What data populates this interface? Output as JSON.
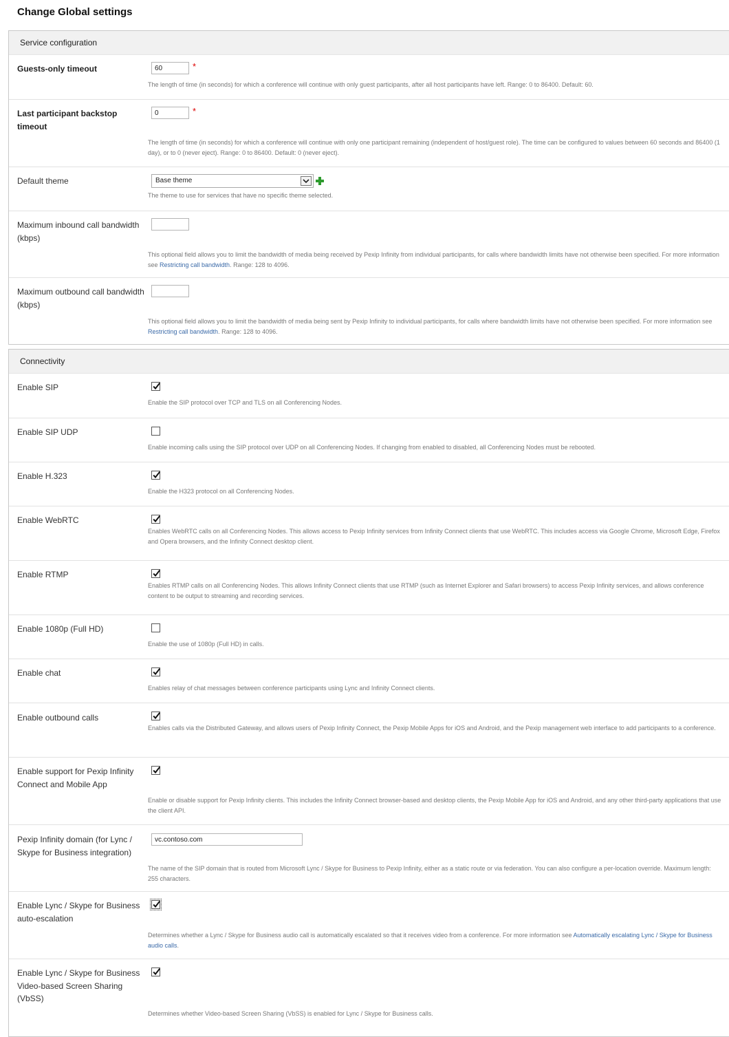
{
  "page": {
    "title": "Change Global settings"
  },
  "service_configuration": {
    "title": "Service configuration",
    "guests_only_timeout": {
      "label": "Guests-only timeout",
      "value": "60",
      "help": "The length of time (in seconds) for which a conference will continue with only guest participants, after all host participants have left. Range: 0 to 86400. Default: 60."
    },
    "last_participant_backstop": {
      "label": "Last participant backstop timeout",
      "value": "0",
      "help": "The length of time (in seconds) for which a conference will continue with only one participant remaining (independent of host/guest role). The time can be configured to values between 60 seconds and 86400 (1 day), or to 0 (never eject). Range: 0 to 86400. Default: 0 (never eject)."
    },
    "default_theme": {
      "label": "Default theme",
      "selected": "Base theme",
      "help": "The theme to use for services that have no specific theme selected."
    },
    "max_inbound_bandwidth": {
      "label": "Maximum inbound call bandwidth (kbps)",
      "value": "",
      "help_before": "This optional field allows you to limit the bandwidth of media being received by Pexip Infinity from individual participants, for calls where bandwidth limits have not otherwise been specified. For more information see ",
      "help_link": "Restricting call bandwidth",
      "help_after": ". Range: 128 to 4096."
    },
    "max_outbound_bandwidth": {
      "label": "Maximum outbound call bandwidth (kbps)",
      "value": "",
      "help_before": "This optional field allows you to limit the bandwidth of media being sent by Pexip Infinity to individual participants, for calls where bandwidth limits have not otherwise been specified. For more information see ",
      "help_link": "Restricting call bandwidth",
      "help_after": ". Range: 128 to 4096."
    }
  },
  "connectivity": {
    "title": "Connectivity",
    "rows": [
      {
        "label": "Enable SIP",
        "checked": true,
        "help": "Enable the SIP protocol over TCP and TLS on all Conferencing Nodes."
      },
      {
        "label": "Enable SIP UDP",
        "checked": false,
        "help": "Enable incoming calls using the SIP protocol over UDP on all Conferencing Nodes. If changing from enabled to disabled, all Conferencing Nodes must be rebooted."
      },
      {
        "label": "Enable H.323",
        "checked": true,
        "help": "Enable the H323 protocol on all Conferencing Nodes."
      },
      {
        "label": "Enable WebRTC",
        "checked": true,
        "help": "Enables WebRTC calls on all Conferencing Nodes. This allows access to Pexip Infinity services from Infinity Connect clients that use WebRTC. This includes access via Google Chrome, Microsoft Edge, Firefox and Opera browsers, and the Infinity Connect desktop client."
      },
      {
        "label": "Enable RTMP",
        "checked": true,
        "help": "Enables RTMP calls on all Conferencing Nodes. This allows Infinity Connect clients that use RTMP (such as Internet Explorer and Safari browsers) to access Pexip Infinity services, and allows conference content to be output to streaming and recording services."
      },
      {
        "label": "Enable 1080p (Full HD)",
        "checked": false,
        "help": "Enable the use of 1080p (Full HD) in calls."
      },
      {
        "label": "Enable chat",
        "checked": true,
        "help": "Enables relay of chat messages between conference participants using Lync and Infinity Connect clients."
      },
      {
        "label": "Enable outbound calls",
        "checked": true,
        "help": "Enables calls via the Distributed Gateway, and allows users of Pexip Infinity Connect, the Pexip Mobile Apps for iOS and Android, and the Pexip management web interface to add participants to a conference."
      },
      {
        "label": "Enable support for Pexip Infinity Connect and Mobile App",
        "checked": true,
        "help": "Enable or disable support for Pexip Infinity clients. This includes the Infinity Connect browser-based and desktop clients, the Pexip Mobile App for iOS and Android, and any other third-party applications that use the client API."
      }
    ],
    "lync_domain": {
      "label": "Pexip Infinity domain (for Lync / Skype for Business integration)",
      "value": "vc.contoso.com",
      "help": "The name of the SIP domain that is routed from Microsoft Lync / Skype for Business to Pexip Infinity, either as a static route or via federation. You can also configure a per-location override. Maximum length: 255 characters."
    },
    "lync_escalation": {
      "label": "Enable Lync / Skype for Business auto-escalation",
      "checked": true,
      "help_before": "Determines whether a Lync / Skype for Business audio call is automatically escalated so that it receives video from a conference. For more information see ",
      "help_link": "Automatically escalating Lync / Skype for Business audio calls",
      "help_after": "."
    },
    "lync_vbss": {
      "label": "Enable Lync / Skype for Business Video-based Screen Sharing (VbSS)",
      "checked": true,
      "help": "Determines whether Video-based Screen Sharing (VbSS) is enabled for Lync / Skype for Business calls."
    }
  }
}
